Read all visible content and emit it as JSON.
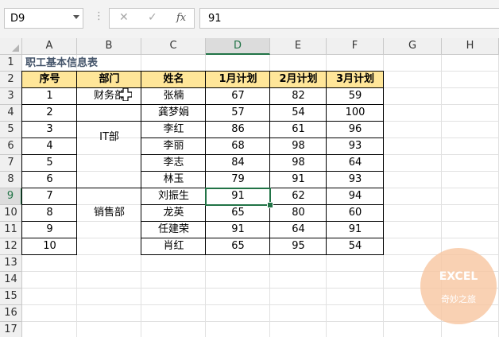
{
  "toolbar": {
    "name_box": "D9",
    "separator": "⋮",
    "cancel_icon": "✕",
    "enter_icon": "✓",
    "fx_label": "fx",
    "formula_value": "91"
  },
  "columns": [
    "A",
    "B",
    "C",
    "D",
    "E",
    "F",
    "G",
    "H"
  ],
  "rows": [
    "1",
    "2",
    "3",
    "4",
    "5",
    "6",
    "7",
    "8",
    "9",
    "10",
    "11",
    "12",
    "13",
    "14",
    "15",
    "16",
    "17"
  ],
  "active_cell": {
    "column": "D",
    "row": "9"
  },
  "sheet": {
    "title": "职工基本信息表",
    "headers": [
      "序号",
      "部门",
      "姓名",
      "1月计划",
      "2月计划",
      "3月计划"
    ],
    "departments": [
      "财务部",
      "IT部",
      "销售部"
    ],
    "records": [
      [
        "1",
        "张楠",
        "67",
        "82",
        "59"
      ],
      [
        "2",
        "龚梦娟",
        "57",
        "54",
        "100"
      ],
      [
        "3",
        "李红",
        "86",
        "61",
        "96"
      ],
      [
        "4",
        "李丽",
        "68",
        "98",
        "93"
      ],
      [
        "5",
        "李志",
        "84",
        "98",
        "64"
      ],
      [
        "6",
        "林玉",
        "79",
        "91",
        "93"
      ],
      [
        "7",
        "刘振生",
        "91",
        "62",
        "94"
      ],
      [
        "8",
        "龙英",
        "65",
        "80",
        "60"
      ],
      [
        "9",
        "任建荣",
        "91",
        "64",
        "91"
      ],
      [
        "10",
        "肖红",
        "65",
        "95",
        "54"
      ]
    ]
  },
  "watermark": {
    "line1": "EXCEL",
    "line2": "奇妙之旅"
  },
  "colors": {
    "header_fill": "#ffe699",
    "title_color": "#44546a",
    "selection": "#217346"
  }
}
